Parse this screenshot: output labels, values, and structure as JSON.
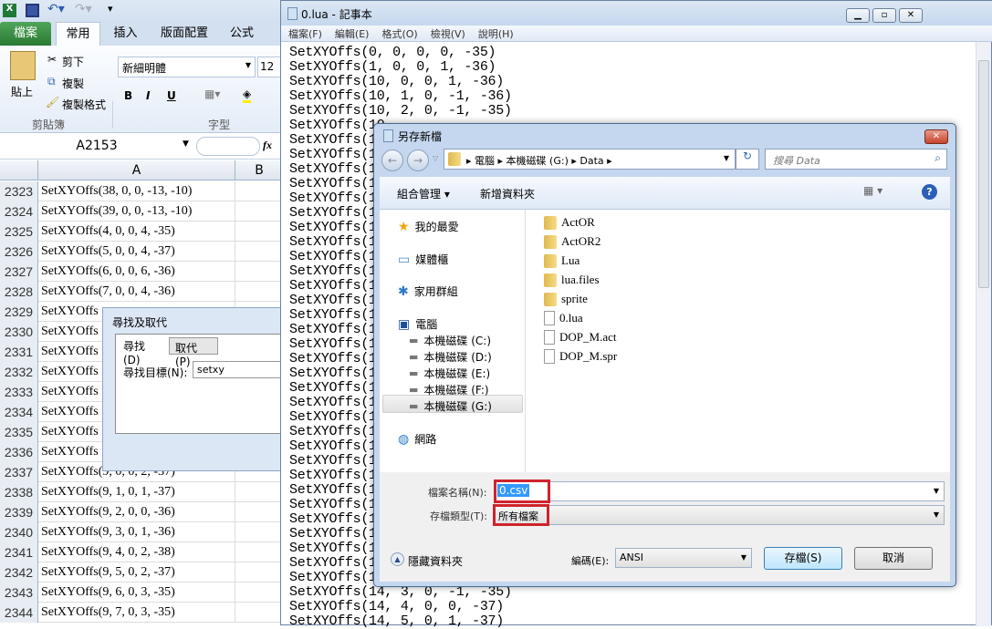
{
  "excel": {
    "qat_icons": [
      "excel-icon",
      "save-icon",
      "undo-icon",
      "redo-icon",
      "customize-icon"
    ],
    "tabs": [
      "檔案",
      "常用",
      "插入",
      "版面配置",
      "公式"
    ],
    "clipboard": {
      "paste": "貼上",
      "cut": "剪下",
      "copy": "複製",
      "format_painter": "複製格式",
      "group": "剪貼簿"
    },
    "font": {
      "name": "新細明體",
      "size": "12",
      "bold": "B",
      "italic": "I",
      "underline": "U",
      "group": "字型"
    },
    "name_box": "A2153",
    "fx": "fx",
    "columns": [
      "A",
      "B"
    ],
    "rows": [
      {
        "n": "2323",
        "v": "SetXYOffs(38, 0, 0, -13, -10)"
      },
      {
        "n": "2324",
        "v": "SetXYOffs(39, 0, 0, -13, -10)"
      },
      {
        "n": "2325",
        "v": "SetXYOffs(4, 0, 0, 4, -35)"
      },
      {
        "n": "2326",
        "v": "SetXYOffs(5, 0, 0, 4, -37)"
      },
      {
        "n": "2327",
        "v": "SetXYOffs(6, 0, 0, 6, -36)"
      },
      {
        "n": "2328",
        "v": "SetXYOffs(7, 0, 0, 4, -36)"
      },
      {
        "n": "2329",
        "v": "SetXYOffs"
      },
      {
        "n": "2330",
        "v": "SetXYOffs"
      },
      {
        "n": "2331",
        "v": "SetXYOffs"
      },
      {
        "n": "2332",
        "v": "SetXYOffs"
      },
      {
        "n": "2333",
        "v": "SetXYOffs"
      },
      {
        "n": "2334",
        "v": "SetXYOffs"
      },
      {
        "n": "2335",
        "v": "SetXYOffs"
      },
      {
        "n": "2336",
        "v": "SetXYOffs"
      },
      {
        "n": "2337",
        "v": "SetXYOffs(9, 0, 0, 2, -37)"
      },
      {
        "n": "2338",
        "v": "SetXYOffs(9, 1, 0, 1, -37)"
      },
      {
        "n": "2339",
        "v": "SetXYOffs(9, 2, 0, 0, -36)"
      },
      {
        "n": "2340",
        "v": "SetXYOffs(9, 3, 0, 1, -36)"
      },
      {
        "n": "2341",
        "v": "SetXYOffs(9, 4, 0, 2, -38)"
      },
      {
        "n": "2342",
        "v": "SetXYOffs(9, 5, 0, 2, -37)"
      },
      {
        "n": "2343",
        "v": "SetXYOffs(9, 6, 0, 3, -35)"
      },
      {
        "n": "2344",
        "v": "SetXYOffs(9, 7, 0, 3, -35)"
      }
    ],
    "find_dialog": {
      "title": "尋找及取代",
      "tab_find": "尋找(D)",
      "tab_replace": "取代(P)",
      "label": "尋找目標(N):",
      "value": "setxy"
    }
  },
  "notepad": {
    "title": "0.lua - 記事本",
    "menu": [
      "檔案(F)",
      "編輯(E)",
      "格式(O)",
      "檢視(V)",
      "說明(H)"
    ],
    "lines": [
      "SetXYOffs(0, 0, 0, 0, -35)",
      "SetXYOffs(1, 0, 0, 1, -36)",
      "SetXYOffs(10, 0, 0, 1, -36)",
      "SetXYOffs(10, 1, 0, -1, -36)",
      "SetXYOffs(10, 2, 0, -1, -35)",
      "SetXYOffs(10",
      "SetXYOffs(10",
      "SetXYOffs(10",
      "SetXYOffs(10",
      "SetXYOffs(10",
      "SetXYOffs(1",
      "SetXYOffs(1",
      "SetXYOffs(1",
      "SetXYOffs(1",
      "SetXYOffs(1",
      "SetXYOffs(1",
      "SetXYOffs(1",
      "SetXYOffs(1",
      "SetXYOffs(12",
      "SetXYOffs(12",
      "SetXYOffs(12",
      "SetXYOffs(12",
      "SetXYOffs(12",
      "SetXYOffs(12",
      "SetXYOffs(12",
      "SetXYOffs(12",
      "SetXYOffs(1",
      "SetXYOffs(1",
      "SetXYOffs(1",
      "SetXYOffs(1",
      "SetXYOffs(1",
      "SetXYOffs(1",
      "SetXYOffs(1",
      "SetXYOffs(14",
      "SetXYOffs(14",
      "SetXYOffs(14",
      "SetXYOffs(14",
      "SetXYOffs(14, 3, 0, -1, -35)",
      "SetXYOffs(14, 4, 0, 0, -37)",
      "SetXYOffs(14, 5, 0, 1, -37)"
    ]
  },
  "save_dialog": {
    "title": "另存新檔",
    "breadcrumb": [
      "電腦",
      "本機磁碟 (G:)",
      "Data"
    ],
    "search_placeholder": "搜尋 Data",
    "organize": "組合管理 ▾",
    "new_folder": "新增資料夾",
    "nav": [
      {
        "label": "我的最愛",
        "icon": "star-icon"
      },
      {
        "label": "媒體櫃",
        "icon": "library-icon"
      },
      {
        "label": "家用群組",
        "icon": "homegroup-icon"
      },
      {
        "label": "電腦",
        "icon": "computer-icon"
      },
      {
        "label": "本機磁碟 (C:)",
        "icon": "drive-icon"
      },
      {
        "label": "本機磁碟 (D:)",
        "icon": "drive-icon"
      },
      {
        "label": "本機磁碟 (E:)",
        "icon": "drive-icon"
      },
      {
        "label": "本機磁碟 (F:)",
        "icon": "drive-icon"
      },
      {
        "label": "本機磁碟 (G:)",
        "icon": "drive-icon"
      },
      {
        "label": "網路",
        "icon": "network-icon"
      }
    ],
    "files": [
      {
        "name": "ActOR",
        "type": "folder"
      },
      {
        "name": "ActOR2",
        "type": "folder"
      },
      {
        "name": "Lua",
        "type": "folder"
      },
      {
        "name": "lua.files",
        "type": "folder"
      },
      {
        "name": "sprite",
        "type": "folder"
      },
      {
        "name": "0.lua",
        "type": "file"
      },
      {
        "name": "DOP_M.act",
        "type": "file"
      },
      {
        "name": "DOP_M.spr",
        "type": "file"
      }
    ],
    "filename_label": "檔案名稱(N):",
    "filename": "0.csv",
    "filetype_label": "存檔類型(T):",
    "filetype": "所有檔案",
    "hide_folders": "隱藏資料夾",
    "encoding_label": "編碼(E):",
    "encoding": "ANSI",
    "save": "存檔(S)",
    "cancel": "取消",
    "highlight_color": "#d0232c"
  }
}
